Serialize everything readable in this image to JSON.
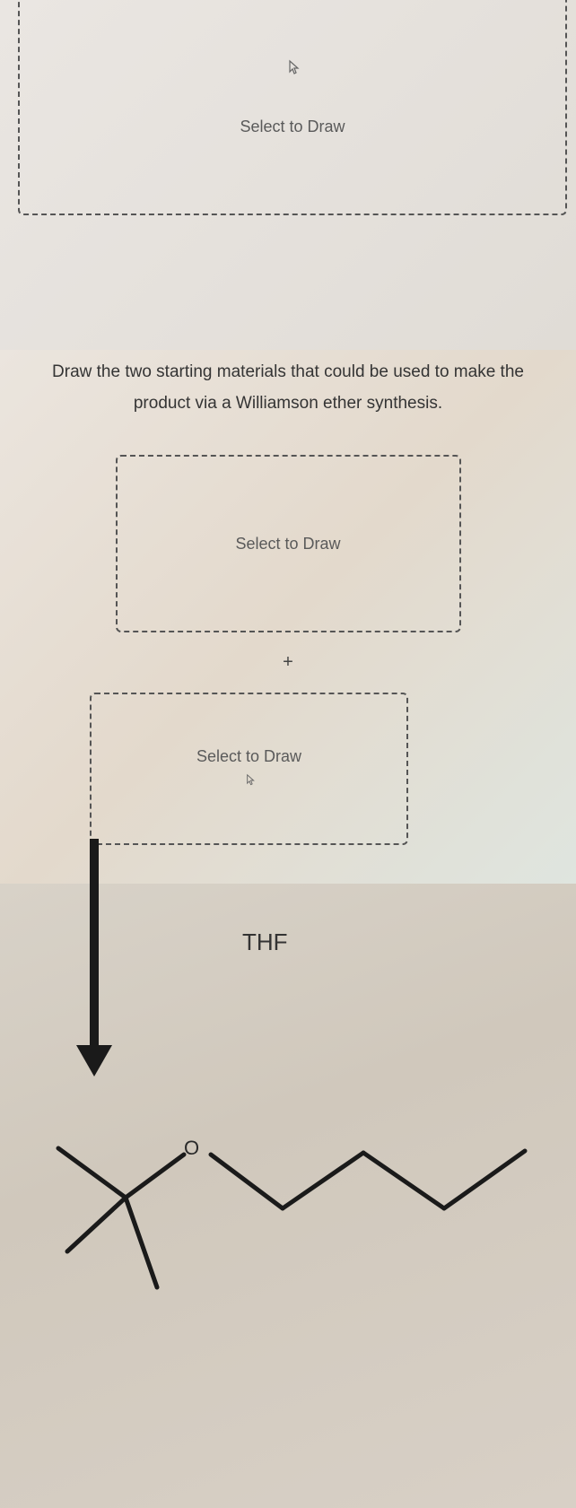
{
  "panel1": {
    "draw_label": "Select to Draw"
  },
  "panel2": {
    "question_line1": "Draw the two starting materials that could be used to make the",
    "question_line2": "product via a Williamson ether synthesis.",
    "draw_label_a": "Select to Draw",
    "plus_symbol": "+",
    "draw_label_b": "Select to Draw"
  },
  "panel3": {
    "solvent_label": "THF",
    "oxygen_atom": "O"
  }
}
